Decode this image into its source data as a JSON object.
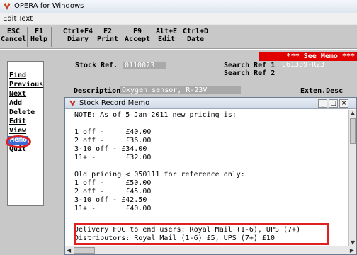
{
  "window": {
    "title": "OPERA for Windows"
  },
  "menu": [
    "Edit",
    "Text"
  ],
  "fkeys": [
    {
      "top": "ESC",
      "bottom": "Cancel"
    },
    {
      "top": "F1",
      "bottom": "Help"
    },
    {
      "top": "Ctrl+F4",
      "bottom": "Diary"
    },
    {
      "top": "F2",
      "bottom": "Print"
    },
    {
      "top": "F9",
      "bottom": "Accept"
    },
    {
      "top": "Alt+E",
      "bottom": "Edit"
    },
    {
      "top": "Ctrl+D",
      "bottom": "Date"
    }
  ],
  "side_menu": {
    "items": [
      "Find",
      "Previous",
      "Next",
      "Add",
      "Delete",
      "Edit",
      "View",
      "Memo",
      "Quit"
    ],
    "selected": "Memo"
  },
  "form": {
    "stock_ref_label": "Stock Ref.",
    "stock_ref_value": "0110023",
    "search_ref1_label": "Search Ref 1",
    "search_ref1_value": "C61339-R23",
    "search_ref2_label": "Search Ref 2",
    "see_memo": "*** See Memo ***",
    "description_label": "Description",
    "description_value": "Oxygen sensor, R-23V",
    "exten_desc": "Exten.Desc"
  },
  "memo": {
    "title": "Stock Record Memo",
    "lines": [
      "NOTE: As of 5 Jan 2011 new pricing is:",
      "",
      "1 off -     £40.00",
      "2 off -     £36.00",
      "3-10 off - £34.00",
      "11+ -       £32.00",
      "",
      "Old pricing < 050111 for reference only:",
      "1 off -     £50.00",
      "2 off -     £45.00",
      "3-10 off - £42.50",
      "11+ -       £40.00",
      "",
      "",
      "Delivery FOC to end users: Royal Mail (1-6), UPS (7+)",
      "Distributors: Royal Mail (1-6) £5, UPS (7+) £10"
    ]
  },
  "colors": {
    "selected": "#3a6ad6",
    "alert": "#e00000",
    "highlight": "#e02020",
    "field_bg": "#a9a9a9"
  }
}
